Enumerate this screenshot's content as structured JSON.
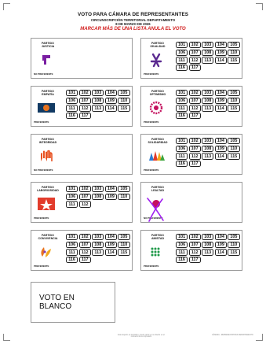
{
  "header": {
    "title": "VOTO PARA CÁMARA DE REPRESENTANTES",
    "circunscripcion": "CIRCUNSCRIPCIÓN TERRITORIAL DEPARTAMENTO",
    "date": "8 DE MARZO DE 2026",
    "warning": "MARCAR MÁS DE UNA LISTA ANULA EL VOTO"
  },
  "parties": [
    {
      "name": "PARTIDO\nJUSTICIA",
      "numbers": [],
      "preferente": "NO PREFERENTE",
      "logo": "justicia-logo"
    },
    {
      "name": "PARTIDO\nIGUALDAD",
      "numbers": [
        "101",
        "102",
        "103",
        "104",
        "105",
        "106",
        "107",
        "108",
        "109",
        "110",
        "111",
        "112",
        "113",
        "114",
        "115",
        "116",
        "117"
      ],
      "preferente": "PREFERENTE",
      "logo": "igualdad-logo"
    },
    {
      "name": "PARTIDO\nEMPATÍA",
      "numbers": [
        "101",
        "102",
        "103",
        "104",
        "105",
        "106",
        "107",
        "108",
        "109",
        "110",
        "111",
        "112",
        "113",
        "114",
        "115",
        "116",
        "117"
      ],
      "preferente": "PREFERENTE",
      "logo": "empatia-logo"
    },
    {
      "name": "PARTIDO\nOPTIMISMO",
      "numbers": [
        "101",
        "102",
        "103",
        "104",
        "105",
        "106",
        "107",
        "108",
        "109",
        "110",
        "111",
        "112",
        "113",
        "114",
        "115",
        "116",
        "117"
      ],
      "preferente": "PREFERENTE",
      "logo": "optimismo-logo"
    },
    {
      "name": "PARTIDO\nINTEGRIDAD",
      "numbers": [],
      "preferente": "NO PREFERENTE",
      "logo": "integridad-logo"
    },
    {
      "name": "PARTIDO\nSOLIDARIDAD",
      "numbers": [
        "101",
        "102",
        "103",
        "104",
        "105",
        "106",
        "107",
        "108",
        "109",
        "110",
        "111",
        "112",
        "113",
        "114",
        "115",
        "116",
        "117"
      ],
      "preferente": "PREFERENTE",
      "logo": "solidaridad-logo"
    },
    {
      "name": "PARTIDO\nLABORIOSIDAD",
      "numbers": [
        "101",
        "102",
        "103",
        "104",
        "105",
        "106",
        "107",
        "108",
        "109",
        "110",
        "111",
        "112"
      ],
      "preferente": "PREFERENTE",
      "logo": "laboriosidad-logo"
    },
    {
      "name": "PARTIDO\nLEALTAD",
      "numbers": [],
      "preferente": "NO PREFERENTE",
      "logo": "lealtad-logo"
    },
    {
      "name": "PARTIDO\nCONVIVENCIA",
      "numbers": [
        "101",
        "102",
        "103",
        "104",
        "105",
        "106",
        "107",
        "108",
        "109",
        "110",
        "111",
        "112",
        "113",
        "114",
        "115",
        "116",
        "117"
      ],
      "preferente": "PREFERENTE",
      "logo": "convivencia-logo"
    },
    {
      "name": "PARTIDO\nAMISTAD",
      "numbers": [
        "101",
        "102",
        "103",
        "104",
        "105",
        "106",
        "107",
        "108",
        "109",
        "110",
        "111",
        "112",
        "113",
        "114",
        "115",
        "116",
        "117"
      ],
      "preferente": "PREFERENTE",
      "logo": "amistad-logo"
    }
  ],
  "blank_vote": "VOTO EN\nBLANCO",
  "footer": {
    "left": "Este tarjetón es ilustrativo, puede variar en su diseño en el momento de su impresión",
    "right": "CÁMARA - REPRESENTANTES DEPARTAMENTO"
  },
  "colors": {
    "warning": "#d11a1a",
    "mark": "#a020f0"
  }
}
